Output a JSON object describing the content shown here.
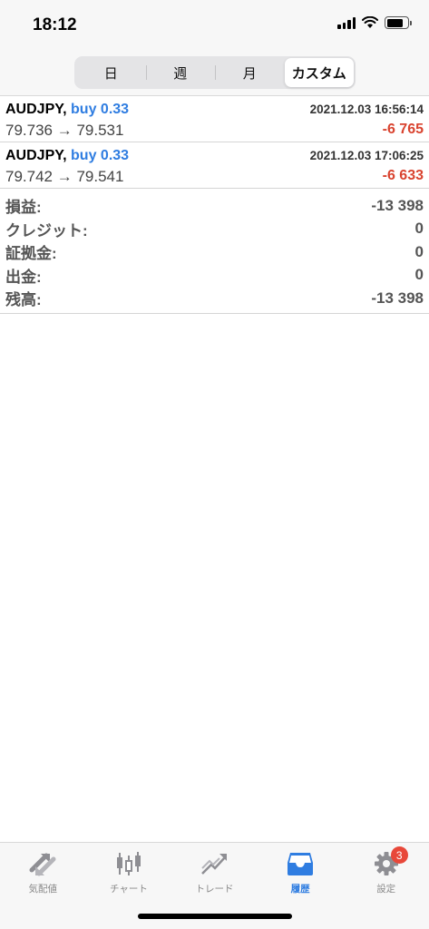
{
  "status": {
    "time": "18:12"
  },
  "period_tabs": [
    {
      "label": "日"
    },
    {
      "label": "週"
    },
    {
      "label": "月"
    },
    {
      "label": "カスタム",
      "active": true
    }
  ],
  "trades": [
    {
      "symbol": "AUDJPY,",
      "side": "buy 0.33",
      "datetime": "2021.12.03 16:56:14",
      "prices": "79.736 → 79.531",
      "profit": "-6 765"
    },
    {
      "symbol": "AUDJPY,",
      "side": "buy 0.33",
      "datetime": "2021.12.03 17:06:25",
      "prices": "79.742 → 79.541",
      "profit": "-6 633"
    }
  ],
  "summary": [
    {
      "label": "損益:",
      "value": "-13 398"
    },
    {
      "label": "クレジット:",
      "value": "0"
    },
    {
      "label": "証拠金:",
      "value": "0"
    },
    {
      "label": "出金:",
      "value": "0"
    },
    {
      "label": "残高:",
      "value": "-13 398"
    }
  ],
  "tabbar": {
    "items": [
      {
        "label": "気配値",
        "icon": "quotes-icon"
      },
      {
        "label": "チャート",
        "icon": "candlestick-icon"
      },
      {
        "label": "トレード",
        "icon": "trade-icon"
      },
      {
        "label": "履歴",
        "icon": "inbox-icon",
        "active": true
      },
      {
        "label": "設定",
        "icon": "gear-icon",
        "badge": "3"
      }
    ]
  },
  "colors": {
    "accent": "#2f7de1",
    "loss": "#d9432f",
    "badge": "#e8483a"
  }
}
